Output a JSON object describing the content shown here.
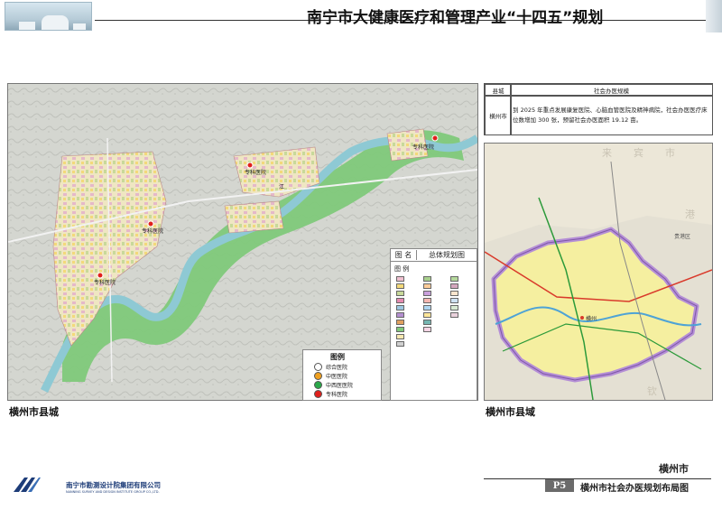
{
  "header": {
    "title": "南宁市大健康医疗和管理产业“十四五”规划"
  },
  "main_map": {
    "caption": "横州市县城",
    "hospital_labels": [
      "专科医院",
      "专科医院",
      "专科医院",
      "专科医院"
    ],
    "place_labels": [
      "江"
    ],
    "overview_legend": {
      "col1": "图 名",
      "col2": "总体规划图",
      "section": "图 例"
    },
    "map_legend": {
      "title": "图例",
      "items": [
        {
          "label": "综合医院",
          "color": "#ffffff"
        },
        {
          "label": "中医医院",
          "color": "#f0a020"
        },
        {
          "label": "中西医医院",
          "color": "#2aa84a"
        },
        {
          "label": "专科医院",
          "color": "#e0201c"
        }
      ]
    }
  },
  "info_table": {
    "header_col1": "县城",
    "header_col2": "社会办医规模",
    "row_col1": "横州市",
    "row_col2": "到 2025 年重点发展康复医院、心脑血管医院及精神病院，社会办医医疗床位数增加 300 张，预留社会办医面积 19.12 亩。"
  },
  "county_map": {
    "caption": "横州市县域",
    "labels": [
      "来",
      "宾",
      "市",
      "港",
      "钦",
      "贵港区",
      "横州"
    ]
  },
  "footer": {
    "company_name": "南宁市勘测设计院集团有限公司",
    "company_name_en": "NANNING SURVEY AND DESIGN INSTITUTE GROUP CO.,LTD.",
    "county": "横州市",
    "page_tag": "P5",
    "page_title": "横州市社会办医规划布局图"
  },
  "colors": {
    "river_green": "#7fc97a",
    "river_water": "#8ec9d4",
    "county_fill": "#f5efa0",
    "county_border": "#b58fd6",
    "company_blue": "#1d3c78"
  }
}
